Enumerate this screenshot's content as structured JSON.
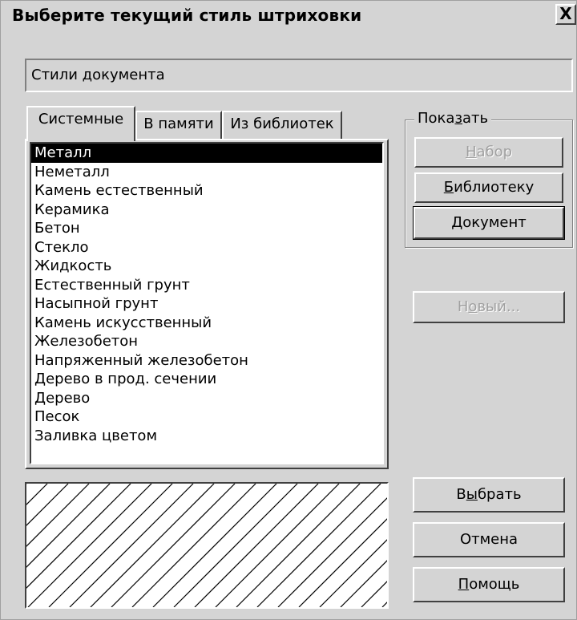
{
  "dialog": {
    "title": "Выберите текущий стиль штриховки",
    "close_glyph": "X"
  },
  "doc_styles_field": "Стили документа",
  "tabs": [
    {
      "label": "Системные",
      "active": true
    },
    {
      "label": "В памяти",
      "active": false
    },
    {
      "label": "Из библиотек",
      "active": false
    }
  ],
  "hatch_list": {
    "selected": "Металл",
    "items": [
      "Металл",
      "Неметалл",
      "Камень естественный",
      "Керамика",
      "Бетон",
      "Стекло",
      "Жидкость",
      "Естественный грунт",
      "Насыпной грунт",
      "Камень искусственный",
      "Железобетон",
      "Напряженный железобетон",
      "Дерево в прод. сечении",
      "Дерево",
      "Песок",
      "Заливка цветом"
    ]
  },
  "show_group": {
    "label_before": "Пока",
    "label_mnemonic": "з",
    "label_after": "ать",
    "buttons": {
      "set": {
        "mnemonic": "Н",
        "rest": "абор",
        "enabled": false
      },
      "library": {
        "mnemonic": "Б",
        "rest": "иблиотеку",
        "enabled": true
      },
      "document": {
        "mnemonic": "Д",
        "rest": "окумент",
        "enabled": true
      }
    }
  },
  "new_button": {
    "before": "Н",
    "mnemonic": "о",
    "after": "вый...",
    "enabled": false
  },
  "select_button": {
    "before": "В",
    "mnemonic": "ы",
    "after": "брать"
  },
  "cancel_button": {
    "label": "Отмена"
  },
  "help_button": {
    "mnemonic": "П",
    "rest": "омощь"
  },
  "preview": {
    "pattern": "diagonal-hatch",
    "line_color": "#000000"
  }
}
